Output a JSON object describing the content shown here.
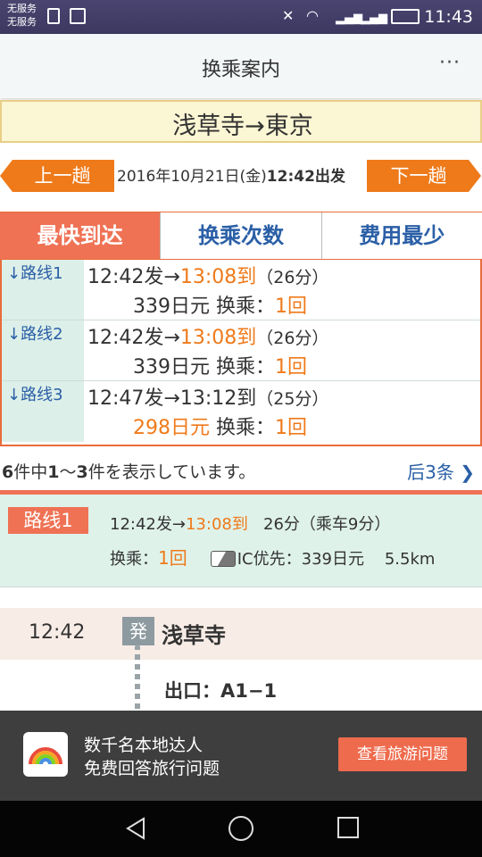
{
  "status": {
    "carrier1": "无服务",
    "carrier2": "无服务",
    "time": "11:43"
  },
  "appbar": {
    "title": "换乘案内",
    "menu_icon": "···"
  },
  "route_header": "浅草寺→東京",
  "nav_row": {
    "prev": "上一趟",
    "next": "下一趟",
    "date": "2016年10月21日(金)",
    "time_label": "12:42出发"
  },
  "tabs": [
    {
      "label": "最快到达",
      "active": true
    },
    {
      "label": "换乘次数",
      "active": false
    },
    {
      "label": "费用最少",
      "active": false
    }
  ],
  "routes": [
    {
      "label": "路线1",
      "dep": "12:42发→",
      "arr": "13:08到",
      "dur": "（26分）",
      "fare": "339日元",
      "transfer_label": "换乘：",
      "transfers": "1回"
    },
    {
      "label": "路线2",
      "dep": "12:42发→",
      "arr": "13:08到",
      "dur": "（26分）",
      "fare": "339日元",
      "transfer_label": "换乘：",
      "transfers": "1回"
    },
    {
      "label": "路线3",
      "dep": "12:47发→",
      "arr": "13:12到",
      "dur": "（25分）",
      "fare": "298日元",
      "transfer_label": "换乘：",
      "transfers": "1回"
    }
  ],
  "count": {
    "total": "6",
    "t1": "件中",
    "range_a": "1",
    "range_sep": "～",
    "range_b": "3",
    "t2": "件を表示しています。"
  },
  "more_link": "后3条",
  "detail": {
    "badge": "路线1",
    "dep": "12:42发→",
    "arr": "13:08到",
    "dur": "26分（乘车9分）",
    "transfer_label": "换乘：",
    "transfers": "1回",
    "ic": "IC优先：339日元",
    "distance": "5.5km"
  },
  "station": {
    "time": "12:42",
    "badge": "発",
    "name": "浅草寺",
    "exit": "出口：A1−1"
  },
  "ad": {
    "line1": "数千名本地达人",
    "line2": "免费回答旅行问题",
    "button": "查看旅游问题"
  },
  "colors": {
    "accent": "#ef7254",
    "orange": "#ef7a1a",
    "link": "#2a5fa6"
  }
}
